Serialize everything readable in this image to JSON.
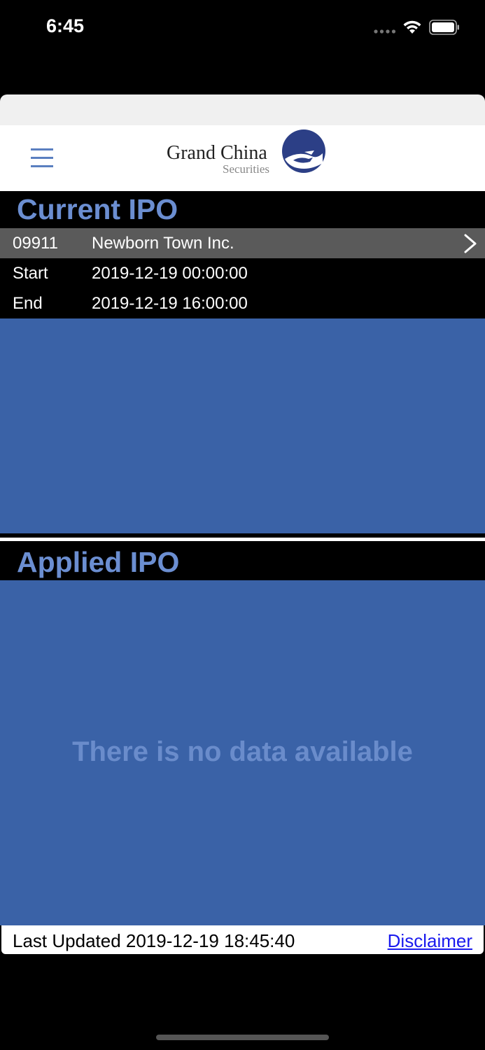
{
  "status_bar": {
    "time": "6:45"
  },
  "header": {
    "menu_icon": "hamburger-menu-icon",
    "logo": {
      "line1": "Grand China",
      "line2": "Securities"
    }
  },
  "current_ipo": {
    "title": "Current IPO",
    "code": "09911",
    "name": "Newborn Town Inc.",
    "start_label": "Start",
    "start_value": "2019-12-19 00:00:00",
    "end_label": "End",
    "end_value": "2019-12-19 16:00:00"
  },
  "applied_ipo": {
    "title": "Applied IPO",
    "empty_message": "There is no data available"
  },
  "footer": {
    "last_updated": "Last Updated 2019-12-19 18:45:40",
    "disclaimer": "Disclaimer"
  },
  "colors": {
    "panel_blue": "#3a62a7",
    "title_blue": "#6b8ed1",
    "row_gray": "#5a5a5a",
    "link_blue": "#1a1aee"
  }
}
